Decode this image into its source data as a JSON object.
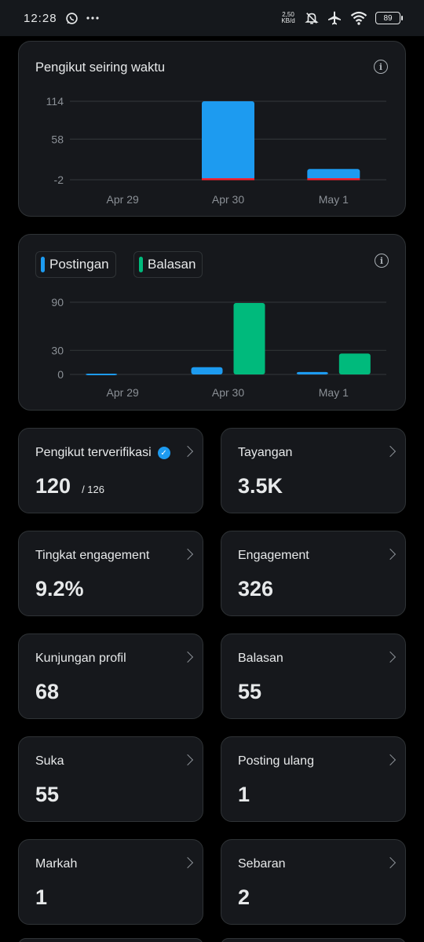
{
  "status_bar": {
    "time": "12:28",
    "net_speed_value": "2,50",
    "net_speed_unit": "KB/d",
    "battery": "89",
    "icons": [
      "whatsapp-icon",
      "more-dots-icon",
      "bell-off-icon",
      "airplane-icon",
      "wifi-icon",
      "battery-icon"
    ]
  },
  "followers_chart": {
    "title": "Pengikut seiring waktu",
    "chart_data": {
      "type": "bar",
      "categories": [
        "Apr 29",
        "Apr 30",
        "May 1"
      ],
      "values": [
        0,
        114,
        14
      ],
      "yticks": [
        114,
        58,
        -2
      ],
      "ylim": [
        -2,
        114
      ],
      "bar_color": "#1d9bf0",
      "baseline_color": "#f4212e",
      "grid": true
    }
  },
  "posts_chart": {
    "chart_data": {
      "type": "bar",
      "categories": [
        "Apr 29",
        "Apr 30",
        "May 1"
      ],
      "yticks": [
        90,
        30,
        0
      ],
      "ylim": [
        0,
        90
      ],
      "grid": true,
      "series": [
        {
          "name": "Postingan",
          "color": "#1d9bf0",
          "values": [
            1,
            9,
            3
          ]
        },
        {
          "name": "Balasan",
          "color": "#00ba7c",
          "values": [
            0,
            89,
            26
          ]
        }
      ]
    }
  },
  "stats": [
    {
      "label": "Pengikut terverifikasi",
      "value": "120",
      "sub": "/ 126",
      "verified": true
    },
    {
      "label": "Tayangan",
      "value": "3.5K"
    },
    {
      "label": "Tingkat engagement",
      "value": "9.2%"
    },
    {
      "label": "Engagement",
      "value": "326"
    },
    {
      "label": "Kunjungan profil",
      "value": "68"
    },
    {
      "label": "Balasan",
      "value": "55"
    },
    {
      "label": "Suka",
      "value": "55"
    },
    {
      "label": "Posting ulang",
      "value": "1"
    },
    {
      "label": "Markah",
      "value": "1"
    },
    {
      "label": "Sebaran",
      "value": "2"
    }
  ],
  "colors": {
    "background": "#000000",
    "card": "#16181c",
    "border": "#2f3336",
    "accent": "#1d9bf0",
    "green": "#00ba7c"
  }
}
